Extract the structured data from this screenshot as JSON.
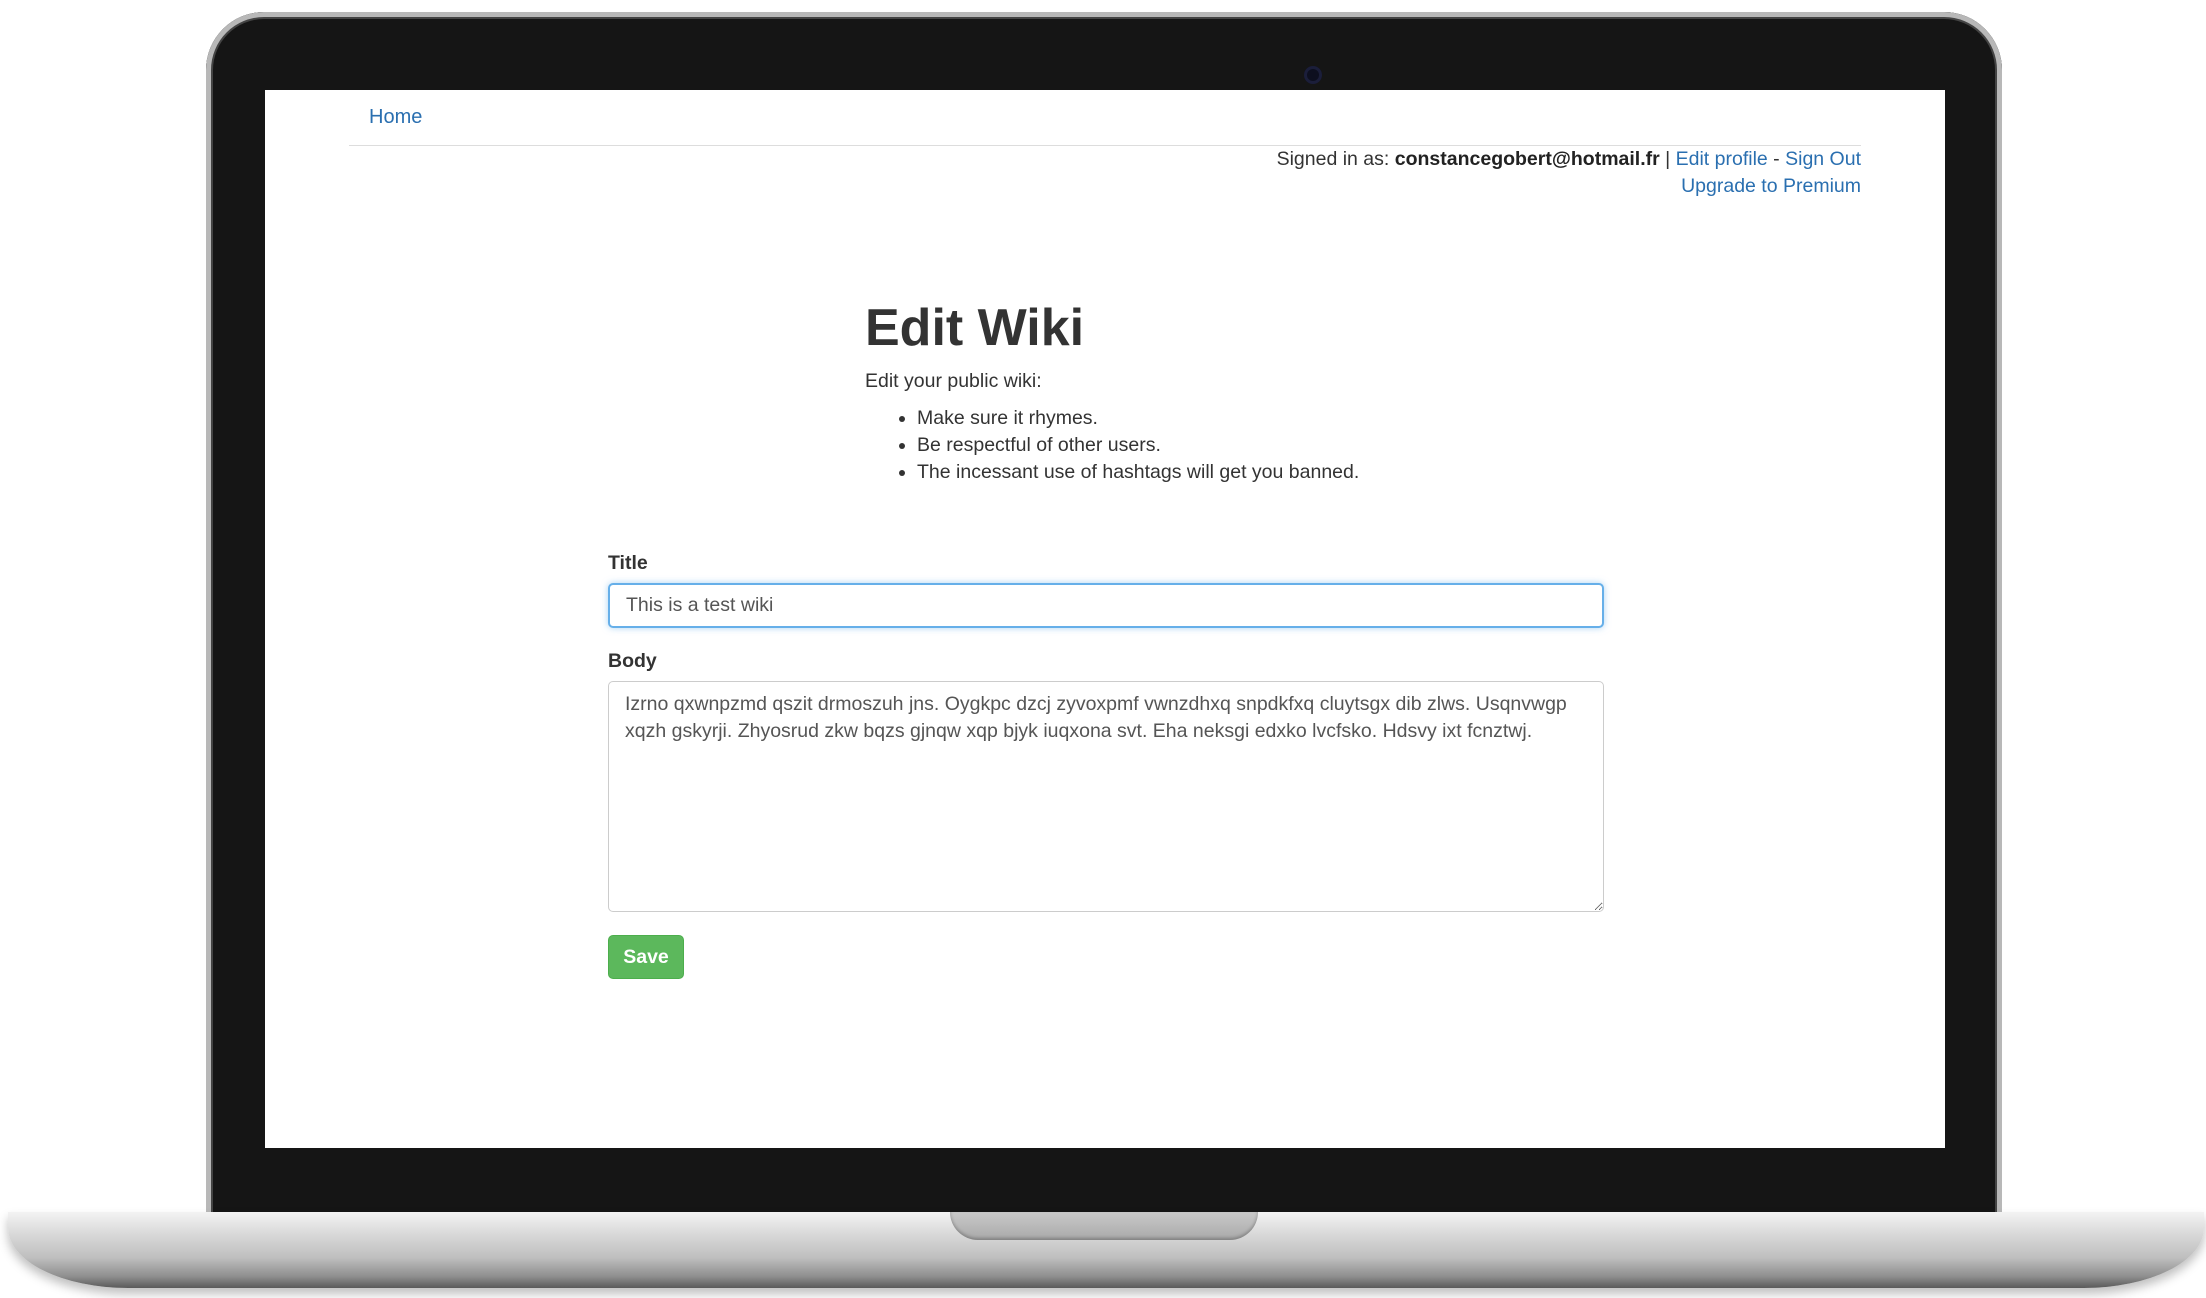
{
  "nav": {
    "home_label": "Home"
  },
  "account": {
    "signed_in_prefix": "Signed in as: ",
    "email": "constancegobert@hotmail.fr",
    "separator_bar": " | ",
    "edit_profile_label": "Edit profile",
    "separator_dash": " - ",
    "sign_out_label": "Sign Out",
    "upgrade_label": "Upgrade to Premium"
  },
  "page": {
    "title": "Edit Wiki",
    "intro": "Edit your public wiki:",
    "rules": [
      "Make sure it rhymes.",
      "Be respectful of other users.",
      "The incessant use of hashtags will get you banned."
    ]
  },
  "form": {
    "title_label": "Title",
    "title_value": "This is a test wiki",
    "body_label": "Body",
    "body_value": "Izrno qxwnpzmd qszit drmoszuh jns. Oygkpc dzcj zyvoxpmf vwnzdhxq snpdkfxq cluytsgx dib zlws. Usqnvwgp xqzh gskyrji. Zhyosrud zkw bqzs gjnqw xqp bjyk iuqxona svt. Eha neksgi edxko lvcfsko. Hdsvy ixt fcnztwj.",
    "save_label": "Save"
  },
  "colors": {
    "link": "#2a6fb0",
    "save_button": "#5cb85c",
    "focus_border": "#66afe9",
    "bezel": "#151515"
  }
}
